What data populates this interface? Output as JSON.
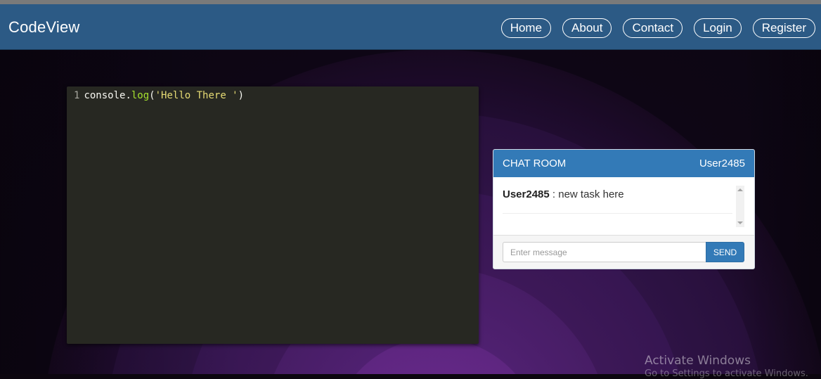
{
  "navbar": {
    "brand": "CodeView",
    "links": [
      "Home",
      "About",
      "Contact",
      "Login",
      "Register"
    ]
  },
  "editor": {
    "line_number": "1",
    "code": {
      "obj": "console.",
      "fn": "log",
      "open": "(",
      "str": "'Hello There '",
      "close": ")"
    }
  },
  "chat": {
    "title": "CHAT ROOM",
    "user": "User2485",
    "messages": [
      {
        "author": "User2485",
        "text": " : new task here"
      }
    ],
    "input_placeholder": "Enter message",
    "send_label": "SEND"
  },
  "watermark": {
    "line1": "Activate Windows",
    "line2": "Go to Settings to activate Windows."
  },
  "colors": {
    "navbar": "#2c5a85",
    "chat_header": "#337ab7",
    "editor_bg": "#272822",
    "background": "#2e1345"
  }
}
